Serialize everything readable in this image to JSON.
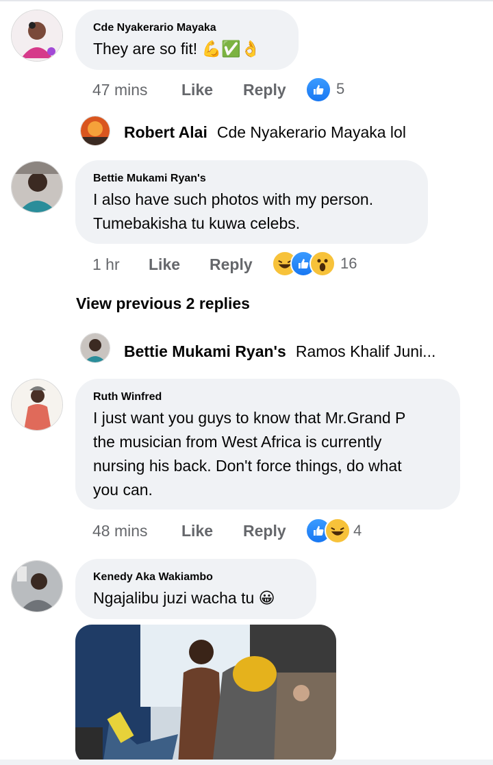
{
  "comments": [
    {
      "name": "Cde Nyakerario Mayaka",
      "text": "They are so fit! 💪✅👌",
      "time": "47 mins",
      "like_label": "Like",
      "reply_label": "Reply",
      "reaction_count": "5",
      "reactions": [
        "like-icon"
      ]
    },
    {
      "name": "Bettie Mukami Ryan's",
      "text_lines": [
        "I also have such photos with my person.",
        "Tumebakisha tu kuwa celebs."
      ],
      "time": "1 hr",
      "like_label": "Like",
      "reply_label": "Reply",
      "reaction_count": "16",
      "reactions": [
        "haha-icon",
        "like-icon",
        "wow-icon"
      ]
    },
    {
      "name": "Ruth Winfred",
      "text_lines": [
        "I just want you guys to know that Mr.Grand P",
        "the musician from West Africa is currently",
        "nursing his back. Don't force things, do what",
        "you can."
      ],
      "time": "48 mins",
      "like_label": "Like",
      "reply_label": "Reply",
      "reaction_count": "4",
      "reactions": [
        "like-icon",
        "haha-icon"
      ]
    },
    {
      "name": "Kenedy Aka Wakiambo",
      "text": "Ngajalibu juzi wacha tu 😀"
    }
  ],
  "replies": [
    {
      "name": "Robert Alai",
      "text": "Cde Nyakerario Mayaka lol"
    },
    {
      "name": "Bettie Mukami Ryan's",
      "text": "Ramos Khalif Juni..."
    }
  ],
  "view_previous": "View previous 2 replies",
  "colors": {
    "bubble": "#f0f2f5",
    "meta": "#65676b",
    "like_blue": "#1877f2",
    "haha_yellow": "#f7c23a"
  }
}
